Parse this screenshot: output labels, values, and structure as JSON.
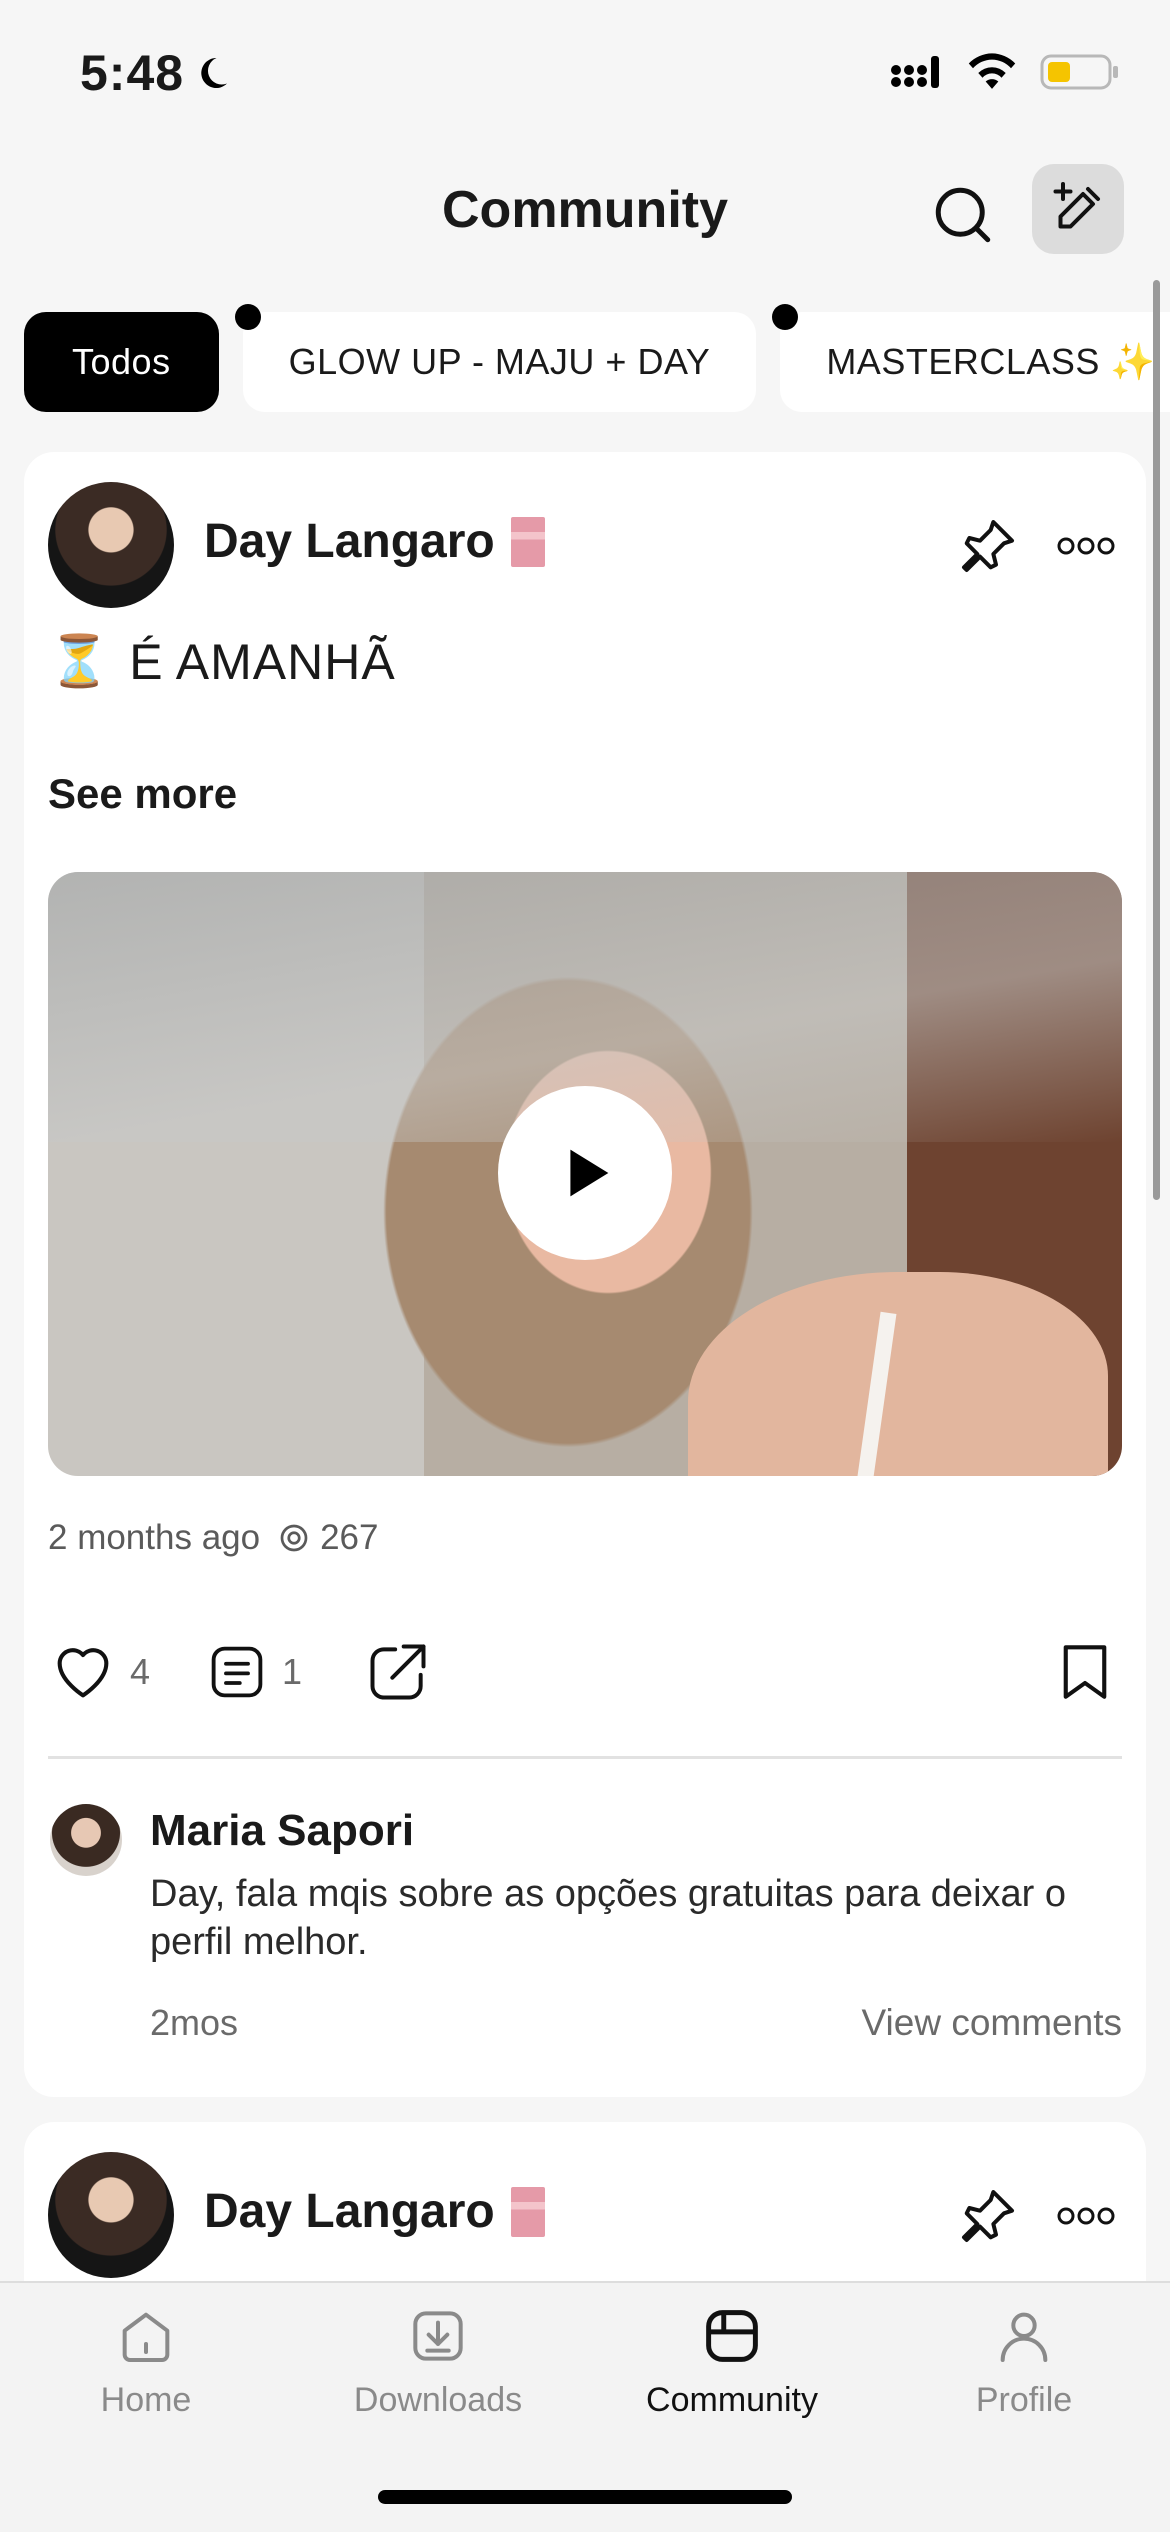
{
  "status_bar": {
    "time": "5:48"
  },
  "header": {
    "title": "Community"
  },
  "chips": [
    {
      "label": "Todos"
    },
    {
      "label": "GLOW UP - MAJU + DAY"
    },
    {
      "label": "MASTERCLASS ✨"
    }
  ],
  "post1": {
    "author": "Day Langaro",
    "text_emoji": "⏳",
    "text": "É AMANHÃ",
    "see_more": "See more",
    "time_ago": "2 months ago",
    "views": "267",
    "likes": "4",
    "comments": "1",
    "comment": {
      "author": "Maria Sapori",
      "text": "Day, fala mqis sobre as opções gratuitas para deixar o perfil melhor.",
      "time": "2mos",
      "view_comments": "View comments"
    }
  },
  "post2": {
    "author": "Day Langaro"
  },
  "tabbar": {
    "tabs": [
      {
        "label": "Home",
        "icon": "home-icon"
      },
      {
        "label": "Downloads",
        "icon": "download-icon"
      },
      {
        "label": "Community",
        "icon": "community-icon"
      },
      {
        "label": "Profile",
        "icon": "profile-icon"
      }
    ],
    "active": "Community"
  }
}
